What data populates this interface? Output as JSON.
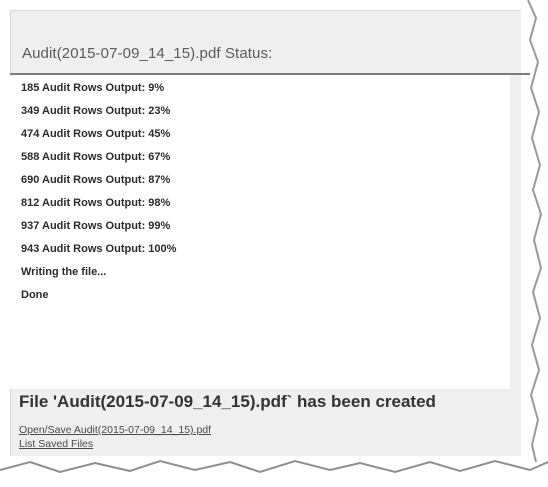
{
  "status": {
    "title": "Audit(2015-07-09_14_15).pdf Status:"
  },
  "log": {
    "lines": [
      "185 Audit Rows Output: 9%",
      "349 Audit Rows Output: 23%",
      "474 Audit Rows Output: 45%",
      "588 Audit Rows Output: 67%",
      "690 Audit Rows Output: 87%",
      "812 Audit Rows Output: 98%",
      "937 Audit Rows Output: 99%",
      "943 Audit Rows Output: 100%",
      "Writing the file...",
      "Done"
    ]
  },
  "result": {
    "message": "File 'Audit(2015-07-09_14_15).pdf` has been created",
    "open_link": "Open/Save Audit(2015-07-09_14_15).pdf",
    "list_link": "List Saved Files"
  },
  "colors": {
    "panel_bg": "#efefef",
    "log_bg": "#ffffff",
    "rule": "#7d7d7d",
    "text": "#2b2b2b"
  }
}
